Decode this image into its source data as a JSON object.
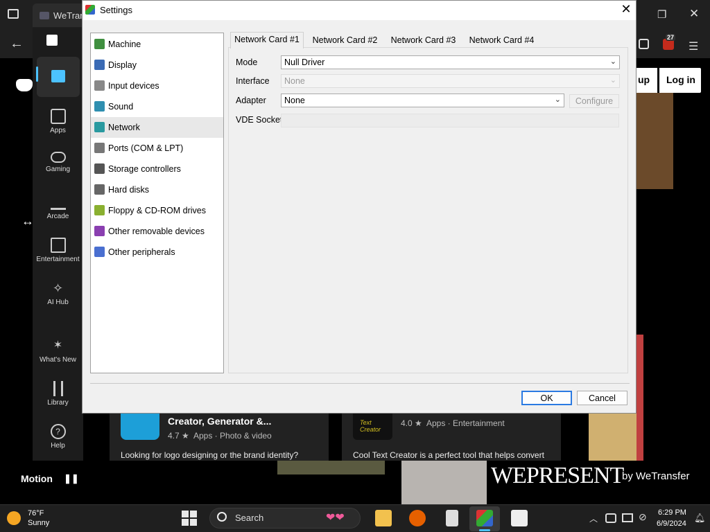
{
  "browser": {
    "tab_title": "WeTrans",
    "notif_count": "27"
  },
  "store_sidebar": {
    "items": [
      {
        "label": "Apps"
      },
      {
        "label": "Gaming"
      },
      {
        "label": "Arcade"
      },
      {
        "label": "Entertainment"
      },
      {
        "label": "AI Hub"
      },
      {
        "label": "What's New"
      },
      {
        "label": "Library"
      },
      {
        "label": "Help"
      }
    ]
  },
  "web": {
    "signup_partial": "up",
    "login": "Log in",
    "motion": "Motion",
    "wepresent": "WEPRESENT",
    "by_wetransfer": "by WeTransfer"
  },
  "cards": [
    {
      "title": "Creator, Generator &...",
      "rating": "4.7 ★",
      "meta": "Apps · Photo & video",
      "desc": "Looking for logo designing or the brand identity?"
    },
    {
      "rating": "4.0 ★",
      "meta": "Apps · Entertainment",
      "desc": "Cool Text Creator is a perfect tool that helps convert",
      "logo_text": "Text Creator"
    }
  ],
  "dialog": {
    "title": "Settings",
    "categories": [
      {
        "label": "Machine",
        "color": "#3f8f3f"
      },
      {
        "label": "Display",
        "color": "#3b6bb5"
      },
      {
        "label": "Input devices",
        "color": "#888888"
      },
      {
        "label": "Sound",
        "color": "#2f8fb0"
      },
      {
        "label": "Network",
        "color": "#2a9aa0"
      },
      {
        "label": "Ports (COM & LPT)",
        "color": "#777777"
      },
      {
        "label": "Storage controllers",
        "color": "#555555"
      },
      {
        "label": "Hard disks",
        "color": "#666666"
      },
      {
        "label": "Floppy & CD-ROM drives",
        "color": "#8ab030"
      },
      {
        "label": "Other removable devices",
        "color": "#8a3fb0"
      },
      {
        "label": "Other peripherals",
        "color": "#4a6fd0"
      }
    ],
    "selected_category": "Network",
    "tabs": [
      "Network Card #1",
      "Network Card #2",
      "Network Card #3",
      "Network Card #4"
    ],
    "fields": {
      "mode_label": "Mode",
      "mode_value": "Null Driver",
      "interface_label": "Interface",
      "interface_value": "None",
      "adapter_label": "Adapter",
      "adapter_value": "None",
      "configure": "Configure",
      "vde_label": "VDE Socket"
    },
    "ok": "OK",
    "cancel": "Cancel"
  },
  "taskbar": {
    "weather_temp": "76°F",
    "weather_desc": "Sunny",
    "search_placeholder": "Search",
    "time": "6:29 PM",
    "date": "6/9/2024"
  }
}
